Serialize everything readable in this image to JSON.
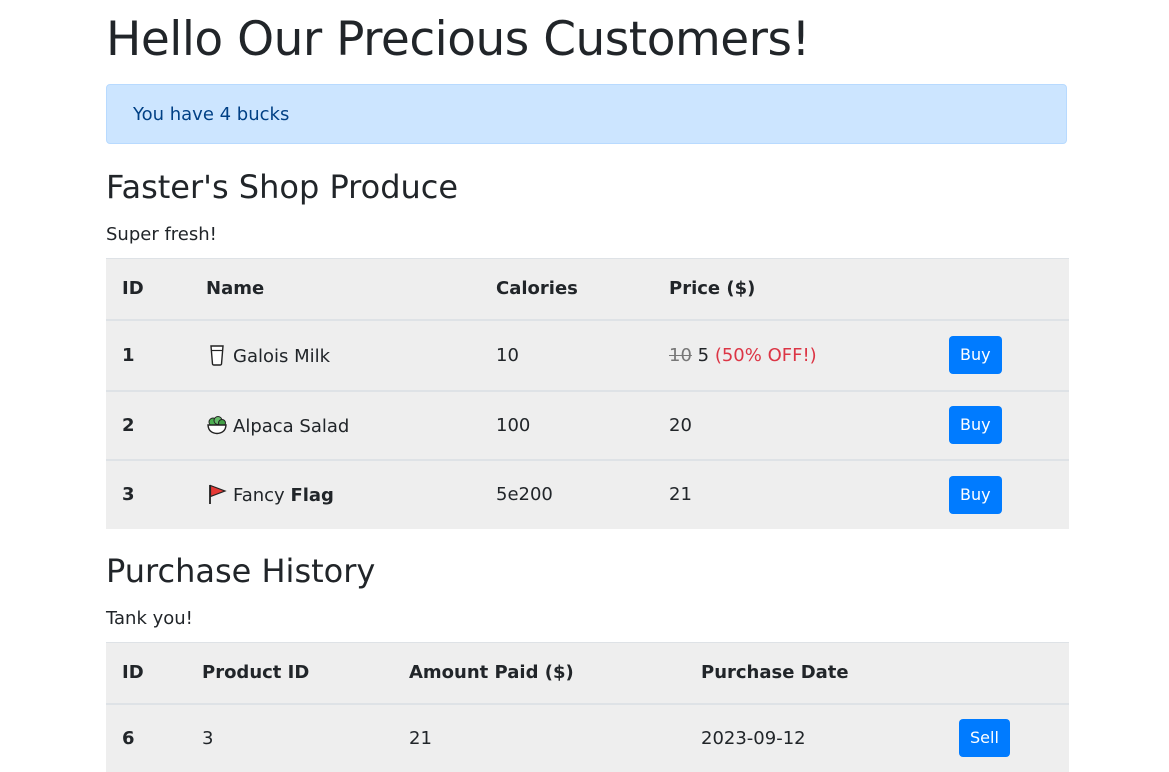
{
  "page_title": "Hello Our Precious Customers!",
  "alert_text": "You have 4 bucks",
  "shop": {
    "title": "Faster's Shop Produce",
    "subtitle": "Super fresh!",
    "columns": [
      "ID",
      "Name",
      "Calories",
      "Price ($)"
    ],
    "rows": [
      {
        "id": "1",
        "icon": "milk-glass-icon",
        "name": "Galois Milk",
        "name_bold": "",
        "calories": "10",
        "old_price": "10",
        "price": "5",
        "discount": "(50% OFF!)",
        "buy_label": "Buy"
      },
      {
        "id": "2",
        "icon": "salad-icon",
        "name": "Alpaca Salad",
        "name_bold": "",
        "calories": "100",
        "old_price": "",
        "price": "20",
        "discount": "",
        "buy_label": "Buy"
      },
      {
        "id": "3",
        "icon": "red-flag-icon",
        "name": "Fancy",
        "name_bold": "Flag",
        "calories": "5e200",
        "old_price": "",
        "price": "21",
        "discount": "",
        "buy_label": "Buy"
      }
    ]
  },
  "history": {
    "title": "Purchase History",
    "subtitle": "Tank you!",
    "columns": [
      "ID",
      "Product ID",
      "Amount Paid ($)",
      "Purchase Date"
    ],
    "rows": [
      {
        "id": "6",
        "product_id": "3",
        "amount_paid": "21",
        "purchase_date": "2023-09-12",
        "sell_label": "Sell"
      }
    ]
  },
  "colors": {
    "primary": "#007bff",
    "alert_bg": "#cce5ff",
    "alert_text": "#004085",
    "discount": "#dc3545",
    "table_bg": "#eeeeee"
  }
}
